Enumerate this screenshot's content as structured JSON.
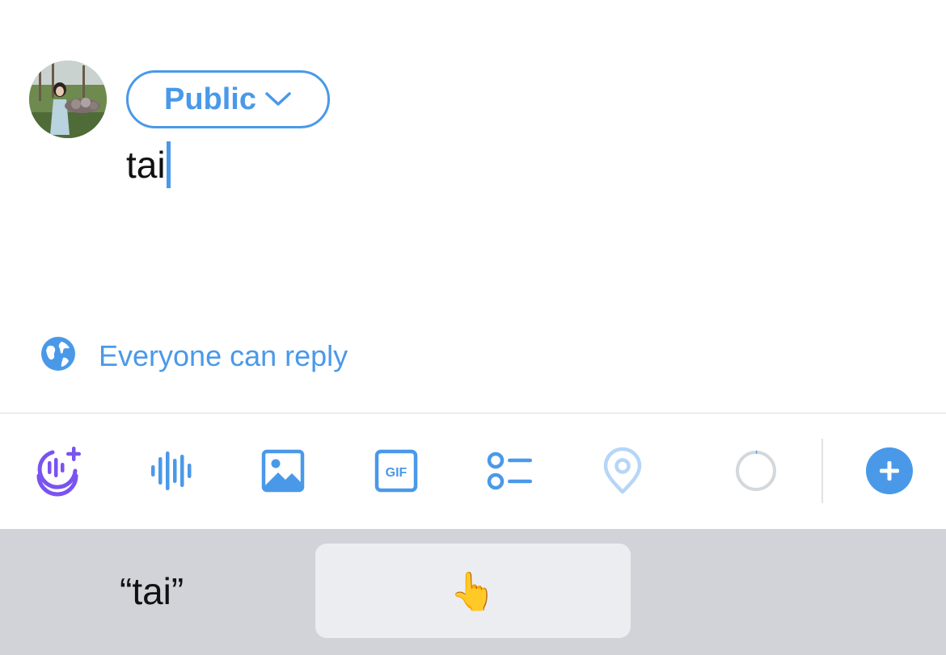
{
  "compose": {
    "audience_label": "Public",
    "text": "tai"
  },
  "reply_setting": {
    "label": "Everyone can reply"
  },
  "toolbar": {
    "icons": [
      "spaces-icon",
      "audio-wave-icon",
      "image-icon",
      "gif-icon",
      "poll-icon",
      "location-icon",
      "character-progress-icon",
      "add-thread-icon"
    ],
    "gif_label": "GIF"
  },
  "keyboard": {
    "suggestion_text": "“tai”",
    "suggestion_emoji": "👆"
  },
  "colors": {
    "accent": "#4a99e9",
    "spaces_purple": "#7a53f0",
    "keyboard_bg": "#d1d3d9"
  }
}
